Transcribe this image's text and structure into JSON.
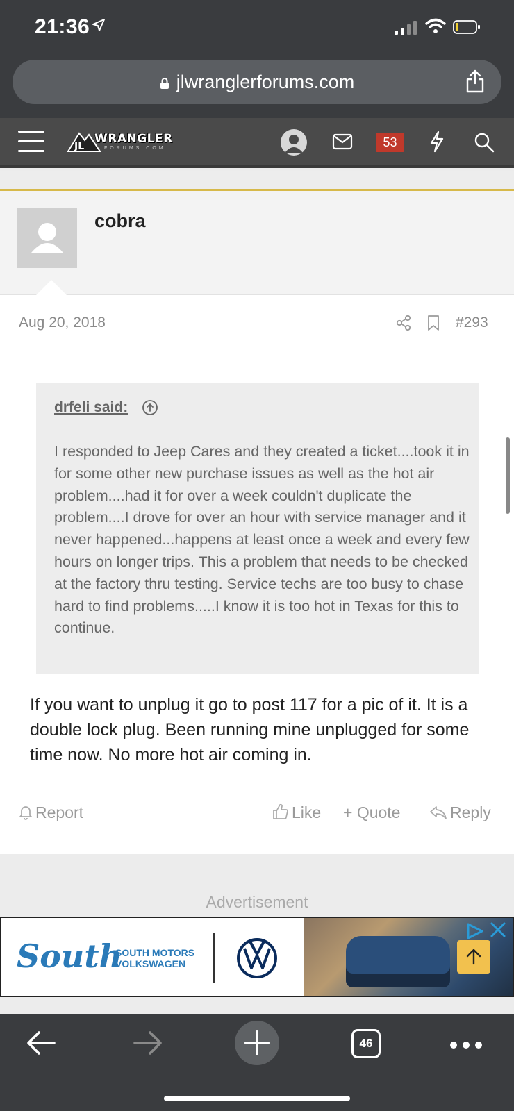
{
  "status_bar": {
    "time": "21:36"
  },
  "browser": {
    "url": "jlwranglerforums.com",
    "tab_count": "46"
  },
  "forum_header": {
    "logo_text": "WRANGLER",
    "logo_subtext": "FORUMS.COM",
    "alerts_count": "53"
  },
  "post": {
    "username": "cobra",
    "date": "Aug 20, 2018",
    "post_number": "#293",
    "quote": {
      "author": "drfeli said:",
      "text": "I responded to Jeep Cares and they created a ticket....took it in for some other new purchase issues as well as the hot air problem....had it for over a week couldn't duplicate the problem....I drove for over an hour with service manager and it never happened...happens at least once a week and every few hours on longer trips. This a problem that needs to be checked at the factory thru testing. Service techs are too busy to chase hard to find problems.....I know it is too hot in Texas for this to continue."
    },
    "body": "If you want to unplug it go to post 117 for a pic of it. It is a double lock plug. Been running mine unplugged for some time now. No more hot air coming in.",
    "actions": {
      "report": "Report",
      "like": "Like",
      "quote": "+ Quote",
      "reply": "Reply"
    }
  },
  "ad": {
    "label": "Advertisement",
    "brand": "South",
    "brand_sub_line1": "SOUTH MOTORS",
    "brand_sub_line2": "VOLKSWAGEN"
  },
  "colors": {
    "accent": "#d7b94a",
    "badge": "#c0392b",
    "ad_blue": "#2a7ab8"
  }
}
